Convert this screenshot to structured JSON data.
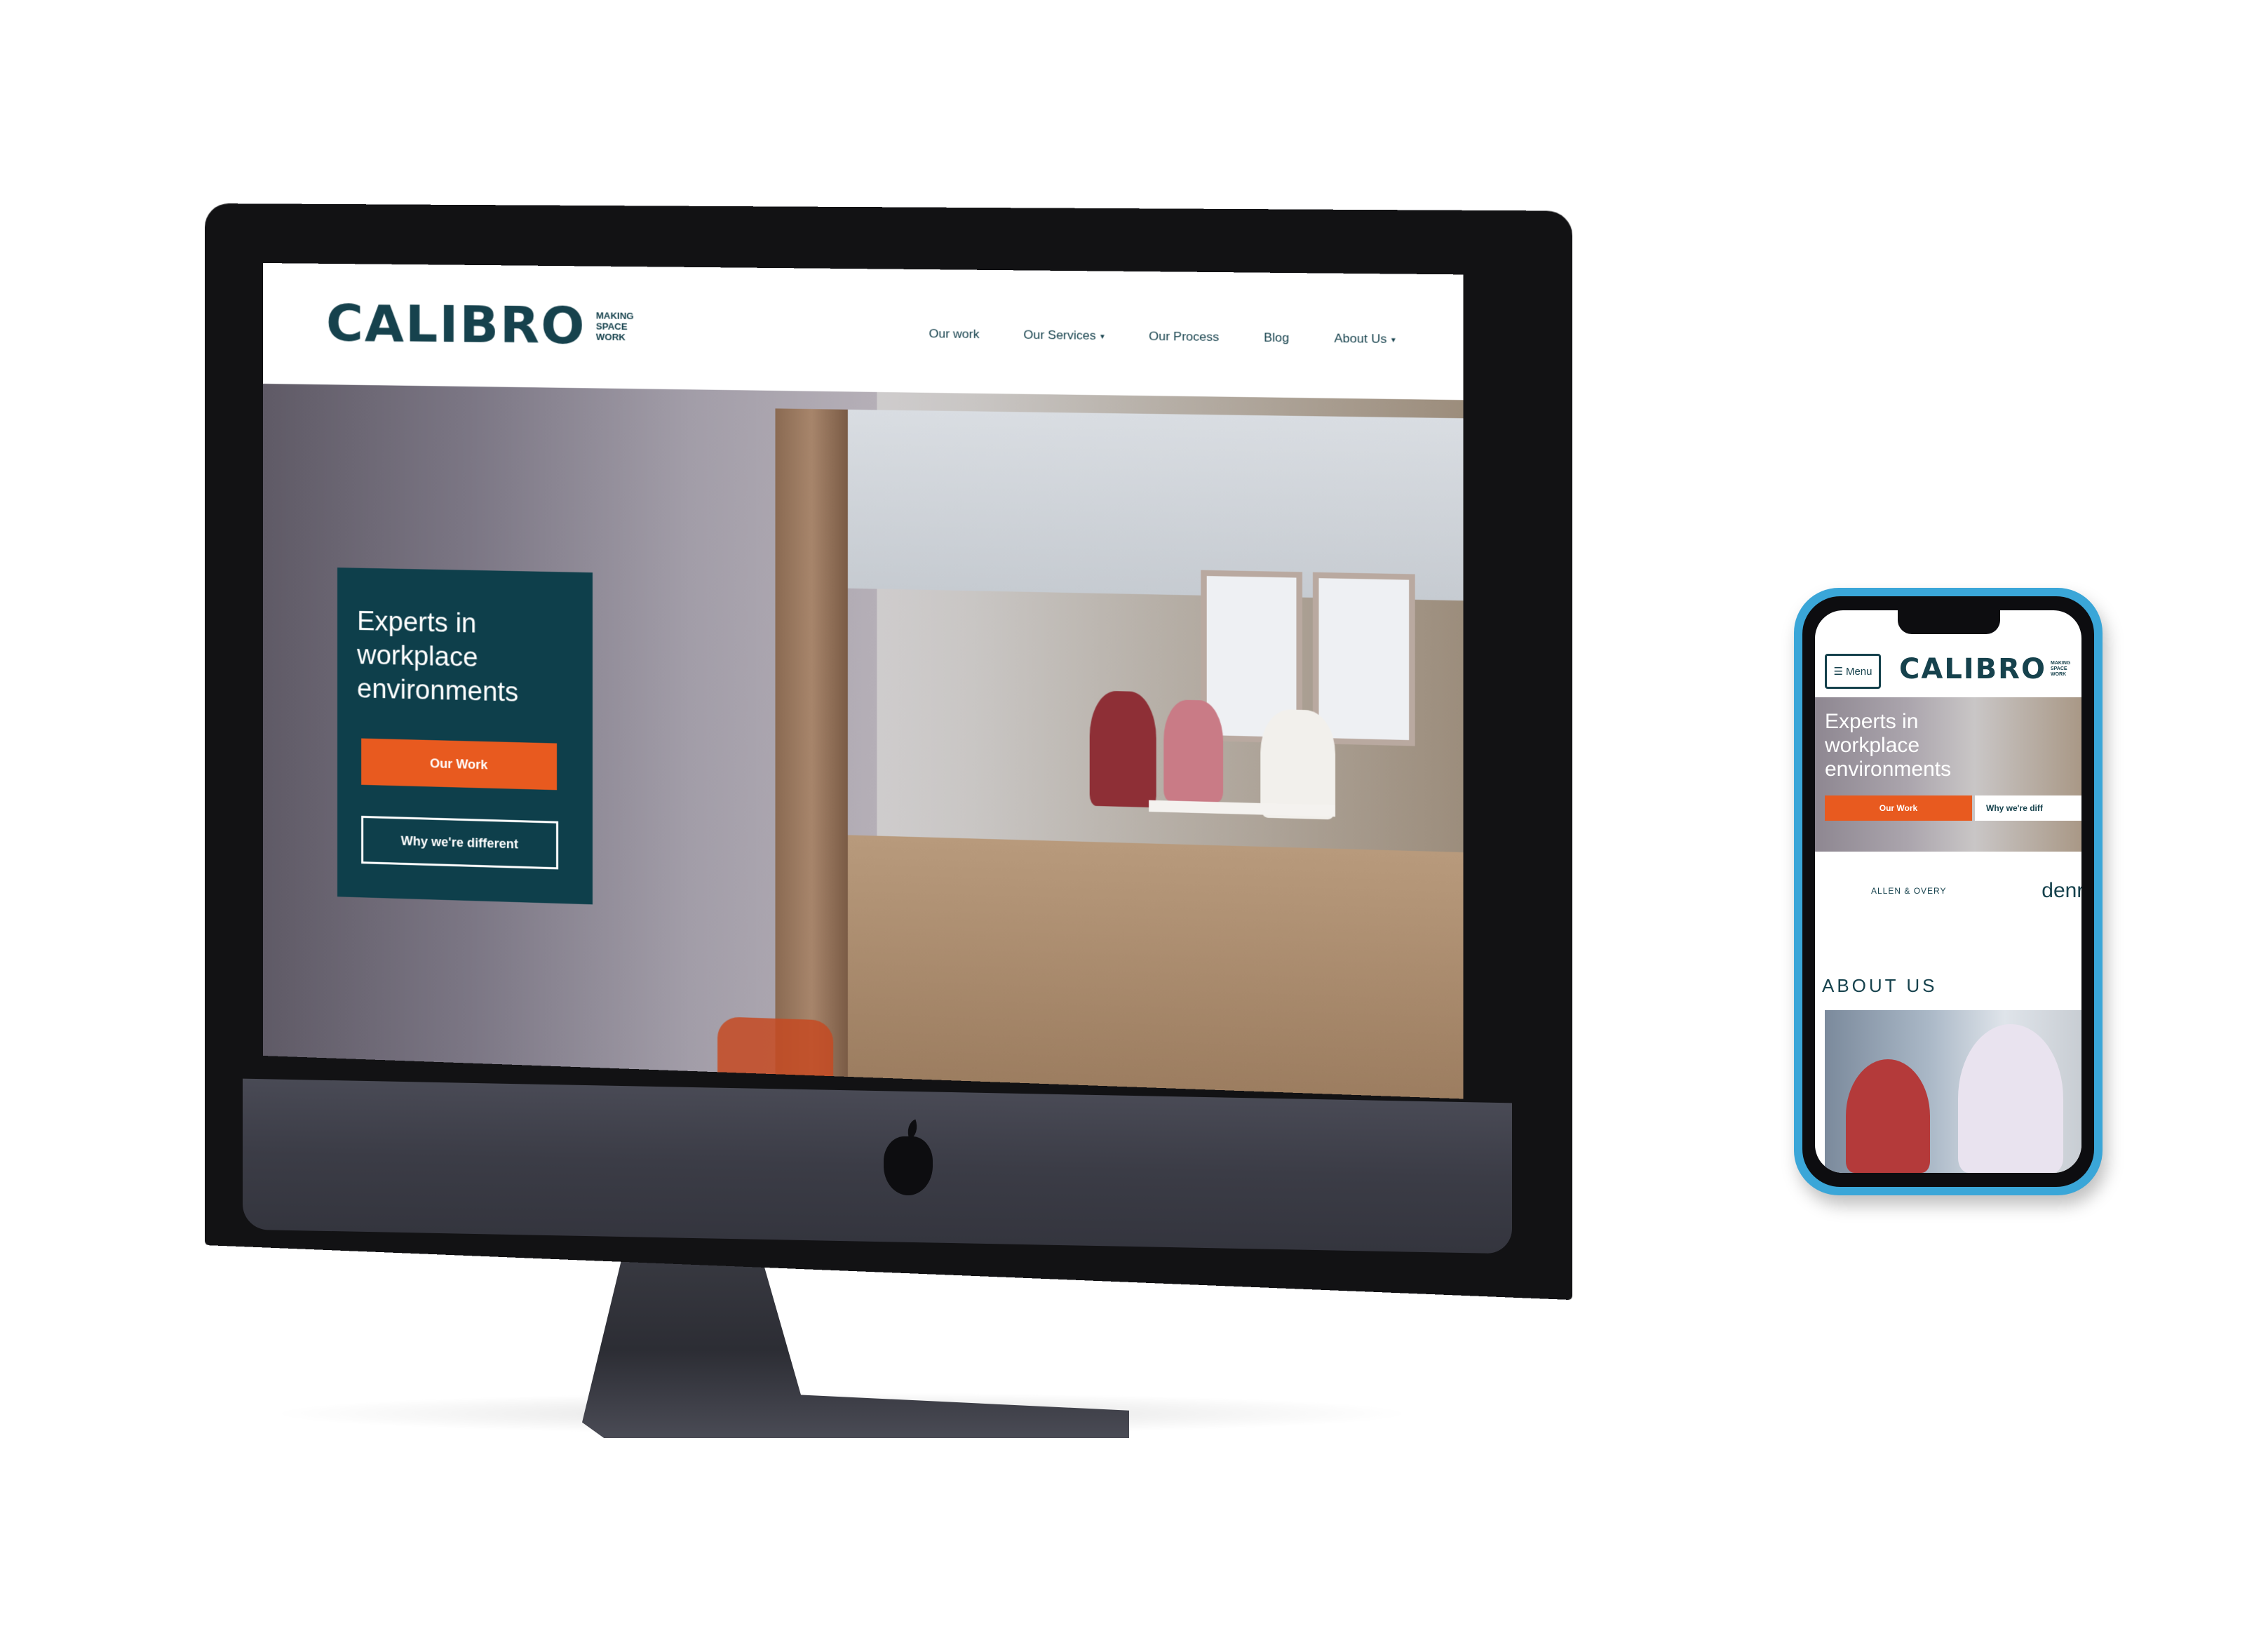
{
  "brand": {
    "name": "CALIBRO",
    "tagline": [
      "MAKING",
      "SPACE",
      "WORK"
    ],
    "primary_color": "#16424d",
    "accent_color": "#e85a1f"
  },
  "desktop": {
    "nav": [
      {
        "label": "Our work",
        "has_caret": false
      },
      {
        "label": "Our Services",
        "has_caret": true
      },
      {
        "label": "Our Process",
        "has_caret": false
      },
      {
        "label": "Blog",
        "has_caret": false
      },
      {
        "label": "About Us",
        "has_caret": true
      }
    ],
    "hero": {
      "title": "Experts in workplace environments",
      "primary_button": "Our Work",
      "secondary_button": "Why we're different"
    }
  },
  "mobile": {
    "menu_label": "Menu",
    "hero": {
      "title": "Experts in workplace environments",
      "primary_button": "Our Work",
      "secondary_button": "Why we're diff"
    },
    "clients": [
      "ALLEN & OVERY",
      "denro"
    ],
    "about_heading": "ABOUT US"
  }
}
